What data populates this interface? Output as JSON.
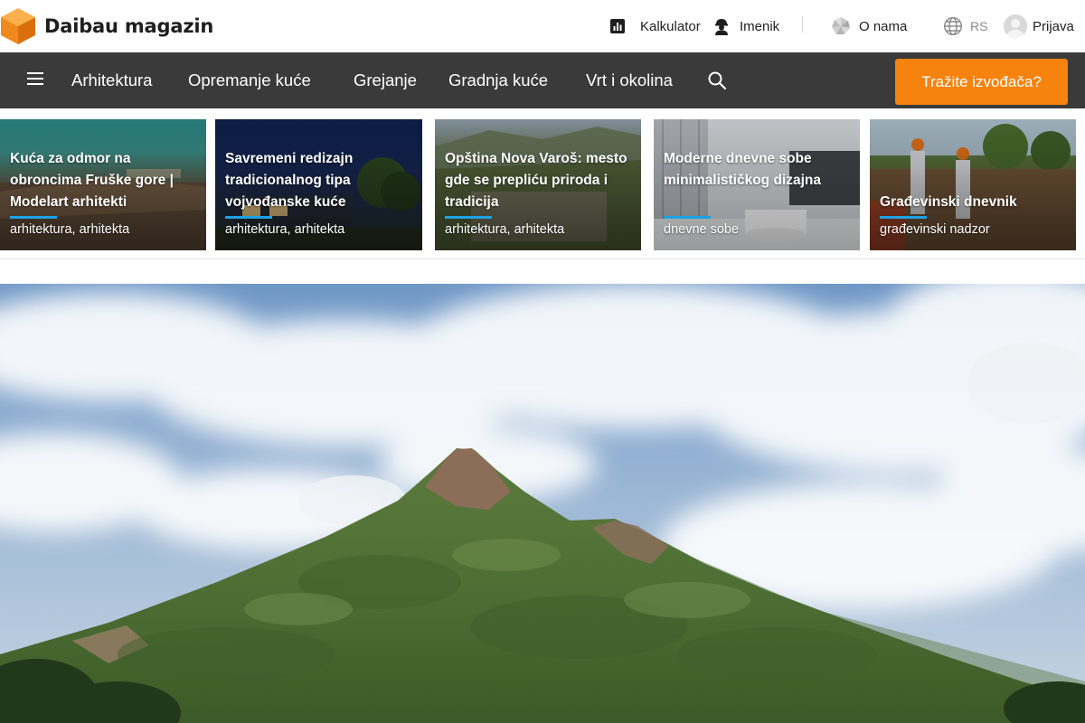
{
  "site": {
    "name": "Daibau magazin",
    "logo_icon": "orange-cube-logo-icon",
    "accent": "#f7830f"
  },
  "utility_nav": {
    "calculator": {
      "label": "Kalkulator",
      "icon": "bar-chart-icon"
    },
    "directory": {
      "label": "Imenik",
      "icon": "worker-icon"
    },
    "about": {
      "label": "O nama",
      "icon": "pinwheel-icon"
    },
    "language": {
      "label": "RS",
      "icon": "globe-icon"
    },
    "login": {
      "label": "Prijava",
      "icon": "avatar-icon"
    }
  },
  "main_nav": {
    "menu_icon": "hamburger-icon",
    "items": [
      {
        "label": "Arhitektura"
      },
      {
        "label": "Opremanje kuće"
      },
      {
        "label": "Grejanje"
      },
      {
        "label": "Gradnja kuće"
      },
      {
        "label": "Vrt i okolina"
      }
    ],
    "search_icon": "search-icon",
    "cta_label": "Tražite izvođača?"
  },
  "cards": [
    {
      "title": "Kuća za odmor na obroncima Fruške gore | Modelart arhitekti",
      "tags": "arhitektura, arhitekta"
    },
    {
      "title": "Savremeni redizajn tradicionalnog tipa vojvođanske kuće",
      "tags": "arhitektura, arhitekta"
    },
    {
      "title": "Opština Nova Varoš: mesto gde se prepliću priroda i tradicija",
      "tags": "arhitektura, arhitekta"
    },
    {
      "title": "Moderne dnevne sobe minimalističkog dizajna",
      "tags": "dnevne sobe"
    },
    {
      "title": "Građevinski dnevnik",
      "tags": "građevinski nadzor"
    }
  ],
  "hero": {
    "image": "mountain-peak-photo"
  }
}
